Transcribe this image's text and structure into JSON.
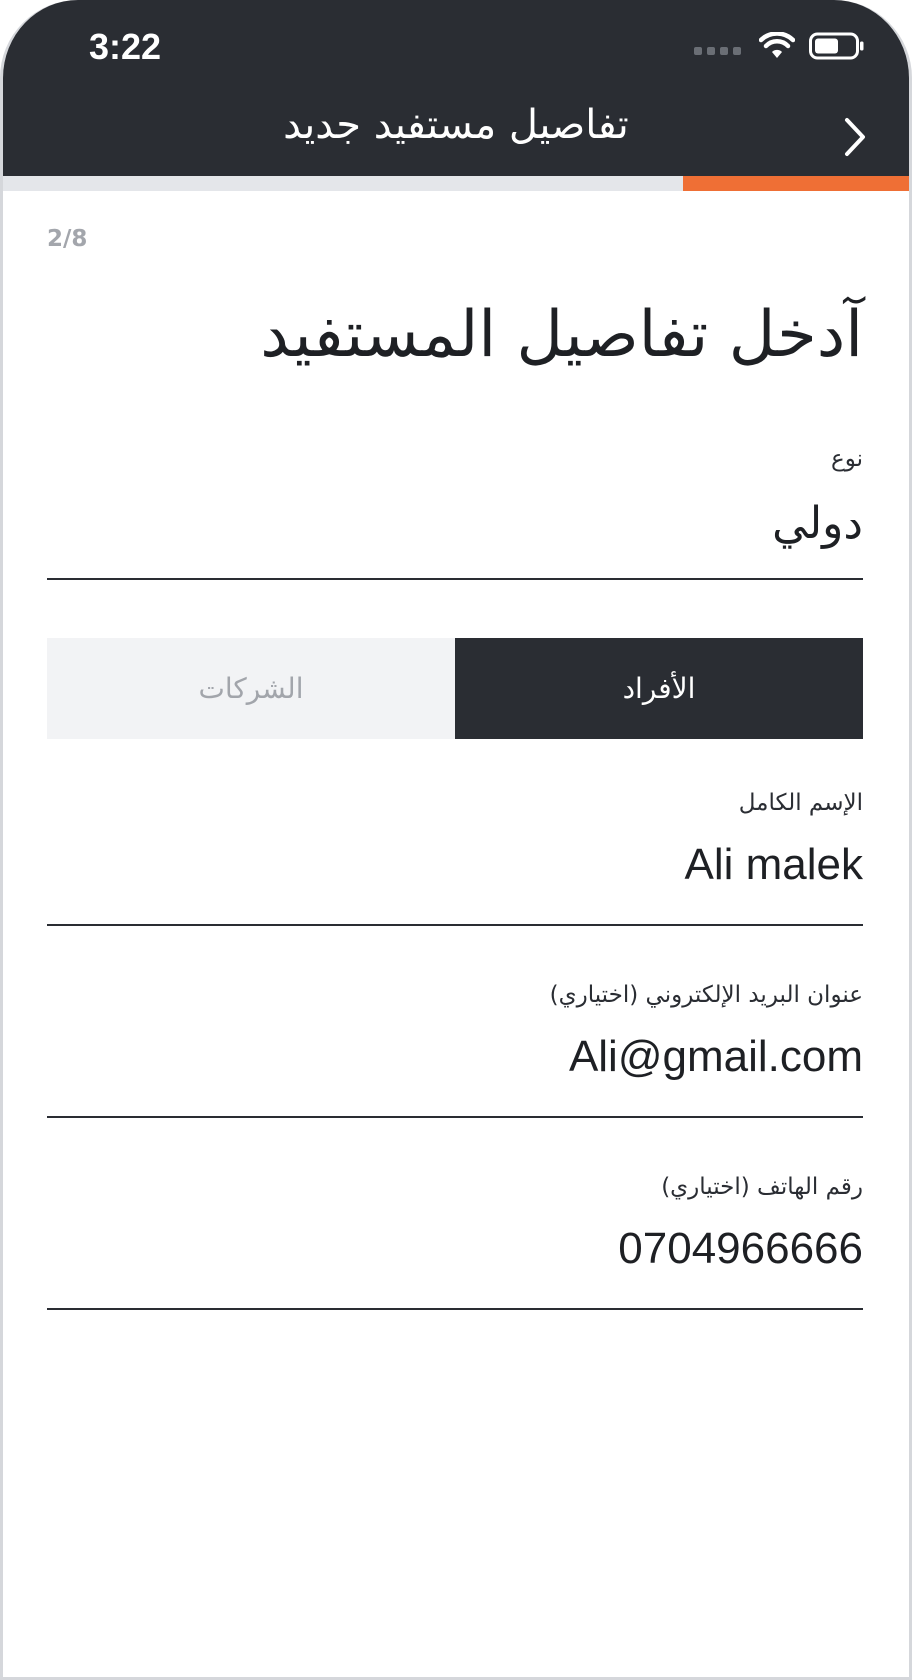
{
  "status_bar": {
    "time": "3:22"
  },
  "header": {
    "title": "تفاصيل مستفيد جديد",
    "back_icon": "chevron-right-icon"
  },
  "progress": {
    "current_step": 2,
    "total_steps": 8,
    "fraction": 0.25,
    "counter_text": "2/8"
  },
  "form": {
    "heading": "آدخل تفاصيل المستفيد",
    "type_field": {
      "label": "نوع",
      "value": "دولي"
    },
    "segments": {
      "companies": "الشركات",
      "individuals": "الأفراد",
      "selected": "individuals"
    },
    "full_name": {
      "label": "الإسم الكامل",
      "value": "Ali malek"
    },
    "email": {
      "label": "عنوان البريد الإلكتروني (اختياري)",
      "value": "Ali@gmail.com"
    },
    "phone": {
      "label": "رقم الهاتف (اختياري)",
      "value": "0704966666"
    }
  },
  "colors": {
    "header_bg": "#2a2d33",
    "accent": "#ef6f35",
    "segment_inactive_bg": "#f2f3f5",
    "segment_inactive_text": "#a2a5ab"
  }
}
